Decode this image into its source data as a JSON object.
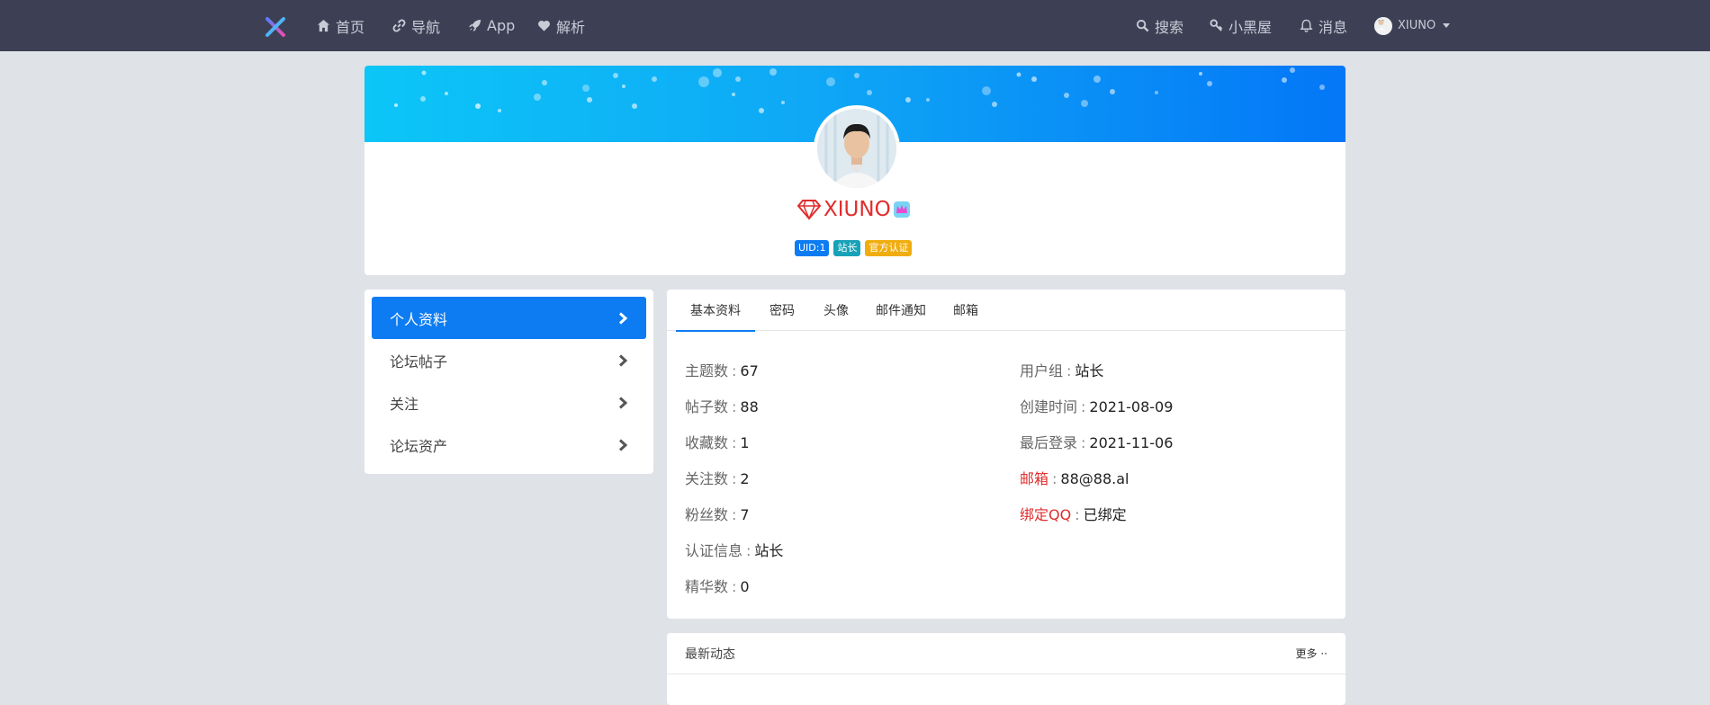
{
  "nav": {
    "items": [
      {
        "label": "首页",
        "icon": "home-icon"
      },
      {
        "label": "导航",
        "icon": "link-icon"
      },
      {
        "label": "App",
        "icon": "rocket-icon"
      },
      {
        "label": "解析",
        "icon": "heart-icon"
      }
    ],
    "right": [
      {
        "label": "搜索",
        "icon": "search-icon"
      },
      {
        "label": "小黑屋",
        "icon": "key-icon"
      },
      {
        "label": "消息",
        "icon": "bell-icon"
      }
    ],
    "user": "XIUNO"
  },
  "profile": {
    "username": "XIUNO",
    "badges": [
      {
        "label": "UID:1",
        "color": "#0d7cf2"
      },
      {
        "label": "站长",
        "color": "#17a2b8"
      },
      {
        "label": "官方认证",
        "color": "#f0ad0e"
      }
    ]
  },
  "menu": {
    "items": [
      "个人资料",
      "论坛帖子",
      "关注",
      "论坛资产"
    ]
  },
  "tabs": [
    "基本资料",
    "密码",
    "头像",
    "邮件通知",
    "邮箱"
  ],
  "info": {
    "left": [
      {
        "label": "主题数",
        "value": "67"
      },
      {
        "label": "帖子数",
        "value": "88"
      },
      {
        "label": "收藏数",
        "value": "1"
      },
      {
        "label": "关注数",
        "value": "2"
      },
      {
        "label": "粉丝数",
        "value": "7"
      },
      {
        "label": "认证信息",
        "value": "站长"
      },
      {
        "label": "精华数",
        "value": "0"
      }
    ],
    "right": [
      {
        "label": "用户组",
        "value": "站长"
      },
      {
        "label": "创建时间",
        "value": "2021-08-09"
      },
      {
        "label": "最后登录",
        "value": "2021-11-06"
      },
      {
        "label": "邮箱",
        "value": "88@88.al"
      },
      {
        "label": "绑定QQ",
        "value": "已绑定"
      }
    ],
    "separator": ":"
  },
  "activity": {
    "title": "最新动态",
    "more": "更多 ··"
  },
  "colors": {
    "nav_bg": "#3d4055",
    "accent": "#0d7cf2",
    "username": "#e02d2d"
  }
}
